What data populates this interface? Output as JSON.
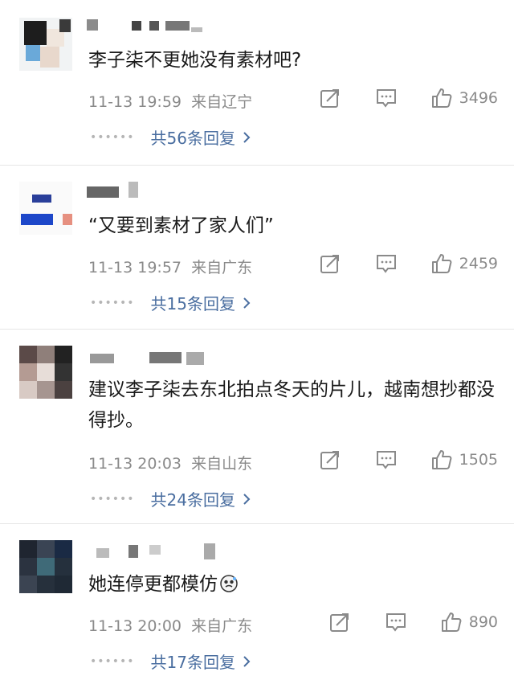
{
  "comments": [
    {
      "text": "李子柒不更她没有素材吧?",
      "date": "11-13 19:59",
      "location": "来自辽宁",
      "likes": "3496",
      "replies": "共56条回复"
    },
    {
      "text": "“又要到素材了家人们”",
      "date": "11-13 19:57",
      "location": "来自广东",
      "likes": "2459",
      "replies": "共15条回复"
    },
    {
      "text": "建议李子柒去东北拍点冬天的片儿，越南想抄都没得抄。",
      "date": "11-13 20:03",
      "location": "来自山东",
      "likes": "1505",
      "replies": "共24条回复"
    },
    {
      "text": "她连停更都模仿",
      "date": "11-13 20:00",
      "location": "来自广东",
      "likes": "890",
      "replies": "共17条回复"
    }
  ],
  "icons": {
    "share": "share-icon",
    "comment": "comment-icon",
    "like": "thumb-up-icon",
    "reply_chevron": "chevron-right-icon",
    "emoji": "emoji-icon"
  },
  "colors": {
    "reply_link": "#4a6ea0",
    "meta": "#8a8a8a",
    "divider": "#e6e6e6"
  }
}
